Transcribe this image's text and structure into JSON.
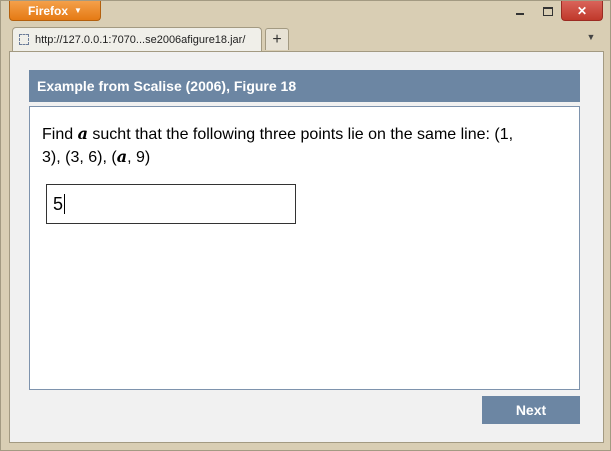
{
  "browser": {
    "app_button_label": "Firefox",
    "tab_title": "http://127.0.0.1:7070...se2006afigure18.jar/",
    "new_tab_label": "+",
    "window_controls": {
      "close": "✕"
    }
  },
  "exercise": {
    "header": "Example from Scalise (2006), Figure 18",
    "question": {
      "part1": "Find ",
      "var1": "a",
      "part2": " sucht that the following three points lie on the same line: (1, 3), (3, 6), (",
      "var2": "a",
      "part3": ", 9)"
    },
    "answer_value": "5",
    "next_label": "Next"
  },
  "colors": {
    "header_bg": "#6c86a3",
    "firefox_orange": "#e57a14",
    "close_red": "#c0392b"
  }
}
